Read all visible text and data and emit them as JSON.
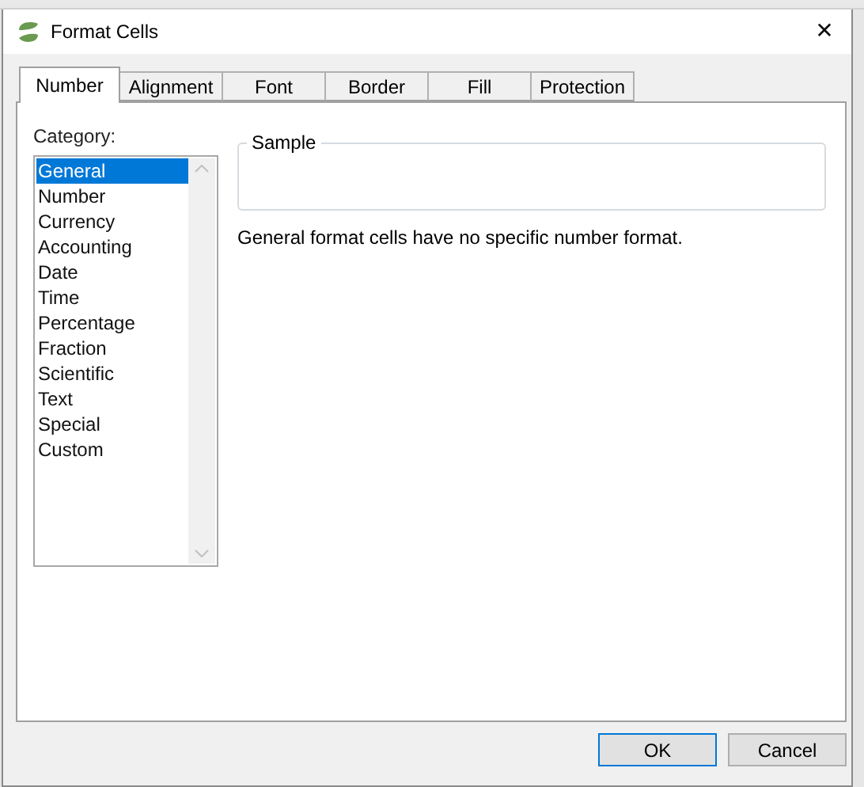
{
  "window": {
    "title": "Format Cells",
    "close": "✕"
  },
  "tabs": [
    {
      "label": "Number",
      "selected": true
    },
    {
      "label": "Alignment",
      "selected": false
    },
    {
      "label": "Font",
      "selected": false
    },
    {
      "label": "Border",
      "selected": false
    },
    {
      "label": "Fill",
      "selected": false
    },
    {
      "label": "Protection",
      "selected": false
    }
  ],
  "category": {
    "label": "Category:",
    "items": [
      {
        "label": "General",
        "selected": true
      },
      {
        "label": "Number",
        "selected": false
      },
      {
        "label": "Currency",
        "selected": false
      },
      {
        "label": "Accounting",
        "selected": false
      },
      {
        "label": "Date",
        "selected": false
      },
      {
        "label": "Time",
        "selected": false
      },
      {
        "label": "Percentage",
        "selected": false
      },
      {
        "label": "Fraction",
        "selected": false
      },
      {
        "label": "Scientific",
        "selected": false
      },
      {
        "label": "Text",
        "selected": false
      },
      {
        "label": "Special",
        "selected": false
      },
      {
        "label": "Custom",
        "selected": false
      }
    ]
  },
  "sample": {
    "label": "Sample"
  },
  "description": "General format cells have no specific number format.",
  "buttons": [
    {
      "label": "OK",
      "default": true
    },
    {
      "label": "Cancel",
      "default": false
    }
  ]
}
